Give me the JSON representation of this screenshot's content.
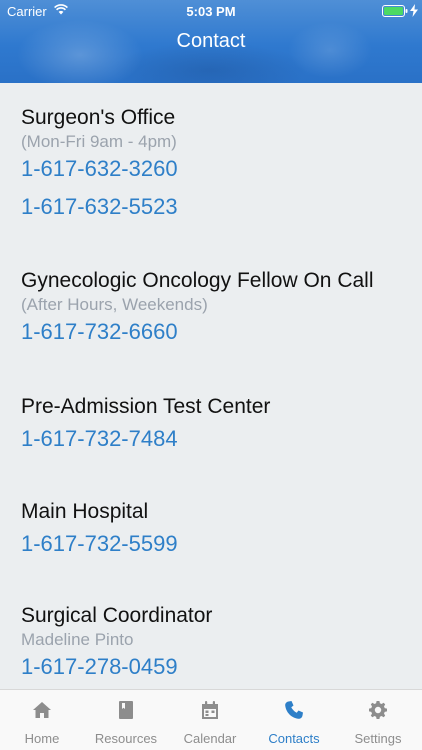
{
  "status_bar": {
    "carrier": "Carrier",
    "time": "5:03 PM"
  },
  "header": {
    "title": "Contact"
  },
  "contacts": [
    {
      "name": "Surgeon's Office",
      "sub": "(Mon-Fri 9am - 4pm)",
      "phones": [
        "1-617-632-3260",
        "1-617-632-5523"
      ]
    },
    {
      "name": "Gynecologic Oncology Fellow On Call",
      "sub": "(After Hours, Weekends)",
      "phones": [
        "1-617-732-6660"
      ]
    },
    {
      "name": "Pre-Admission Test Center",
      "phones": [
        "1-617-732-7484"
      ]
    },
    {
      "name": "Main Hospital",
      "phones": [
        "1-617-732-5599"
      ]
    },
    {
      "name": "Surgical Coordinator",
      "sub": "Madeline Pinto",
      "phones": [
        "1-617-278-0459"
      ]
    }
  ],
  "tabs": [
    {
      "label": "Home",
      "icon": "home-icon"
    },
    {
      "label": "Resources",
      "icon": "book-icon"
    },
    {
      "label": "Calendar",
      "icon": "calendar-icon"
    },
    {
      "label": "Contacts",
      "icon": "phone-icon",
      "active": true
    },
    {
      "label": "Settings",
      "icon": "gear-icon"
    }
  ],
  "colors": {
    "accent": "#2e7fc8",
    "header": "#2f79cf",
    "background": "#ebeef0",
    "muted": "#9ba3ad",
    "tab_inactive": "#8d8d8d"
  }
}
